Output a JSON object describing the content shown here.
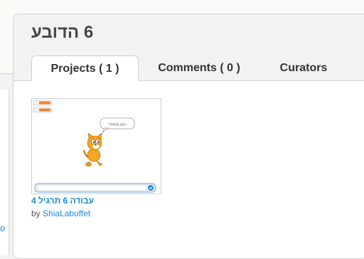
{
  "studio": {
    "title": "עבודה 6"
  },
  "tabs": [
    {
      "label": "Projects ( 1 )",
      "active": true
    },
    {
      "label": "Comments ( 0 )",
      "active": false
    },
    {
      "label": "Curators",
      "active": false
    }
  ],
  "projects": [
    {
      "title": "עבודה 6 תרגיל 4",
      "by_label": "by",
      "author": "ShiaLabuffet",
      "thumbnail": {
        "speech_bubble_text": "הננו מתחיל",
        "icon": "scratch-cat-icon"
      }
    }
  ],
  "left_panel": {
    "fragment_text": "o"
  },
  "colors": {
    "link": "#1a8cd0",
    "title": "#474747",
    "header_bg": "#f2f2f2"
  }
}
